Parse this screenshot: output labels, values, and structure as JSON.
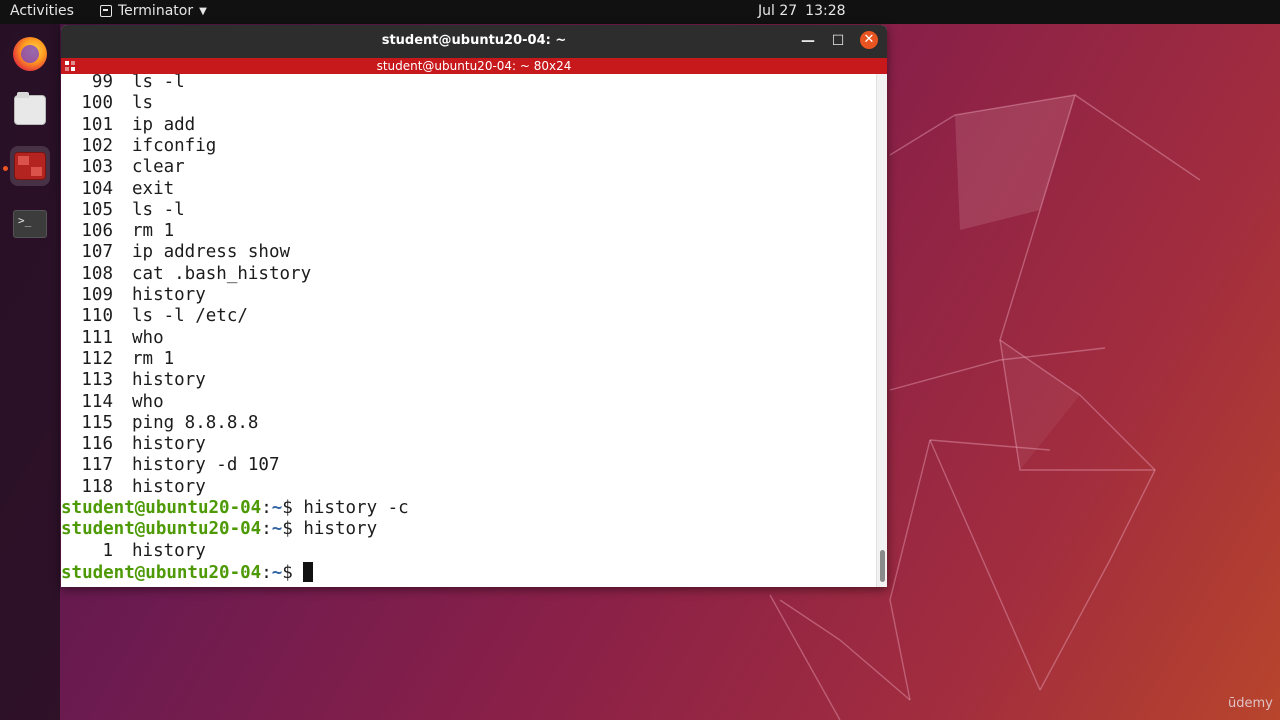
{
  "topbar": {
    "activities": "Activities",
    "app_name": "Terminator",
    "date": "Jul 27",
    "time": "13:28"
  },
  "dock": {
    "items": [
      {
        "name": "firefox",
        "active": false
      },
      {
        "name": "files",
        "active": false
      },
      {
        "name": "terminator",
        "active": true
      },
      {
        "name": "terminal",
        "active": false
      }
    ],
    "terminal_glyph": ">_"
  },
  "window": {
    "title": "student@ubuntu20-04: ~",
    "tab_title": "student@ubuntu20-04: ~ 80x24",
    "controls": {
      "minimize": "—",
      "maximize": "☐",
      "close": "✕"
    }
  },
  "terminal": {
    "history": [
      {
        "num": "99",
        "cmd": "ls -l"
      },
      {
        "num": "100",
        "cmd": "ls"
      },
      {
        "num": "101",
        "cmd": "ip add"
      },
      {
        "num": "102",
        "cmd": "ifconfig"
      },
      {
        "num": "103",
        "cmd": "clear"
      },
      {
        "num": "104",
        "cmd": "exit"
      },
      {
        "num": "105",
        "cmd": "ls -l"
      },
      {
        "num": "106",
        "cmd": "rm 1"
      },
      {
        "num": "107",
        "cmd": "ip address show"
      },
      {
        "num": "108",
        "cmd": "cat .bash_history"
      },
      {
        "num": "109",
        "cmd": "history"
      },
      {
        "num": "110",
        "cmd": "ls -l /etc/"
      },
      {
        "num": "111",
        "cmd": "who"
      },
      {
        "num": "112",
        "cmd": "rm 1"
      },
      {
        "num": "113",
        "cmd": "history"
      },
      {
        "num": "114",
        "cmd": "who"
      },
      {
        "num": "115",
        "cmd": "ping 8.8.8.8"
      },
      {
        "num": "116",
        "cmd": "history"
      },
      {
        "num": "117",
        "cmd": "history -d 107"
      },
      {
        "num": "118",
        "cmd": "history"
      }
    ],
    "prompt_user": "student@ubuntu20-04",
    "prompt_sep": ":",
    "prompt_path": "~",
    "prompt_symbol": "$ ",
    "command_1": "history -c",
    "command_2": "history",
    "output_num": "1",
    "output_cmd": "history"
  },
  "watermark": "ūdemy",
  "colors": {
    "tab_bar": "#c7181b",
    "prompt_user": "#4e9a06",
    "prompt_path": "#3465a4",
    "close_button": "#e95420"
  }
}
